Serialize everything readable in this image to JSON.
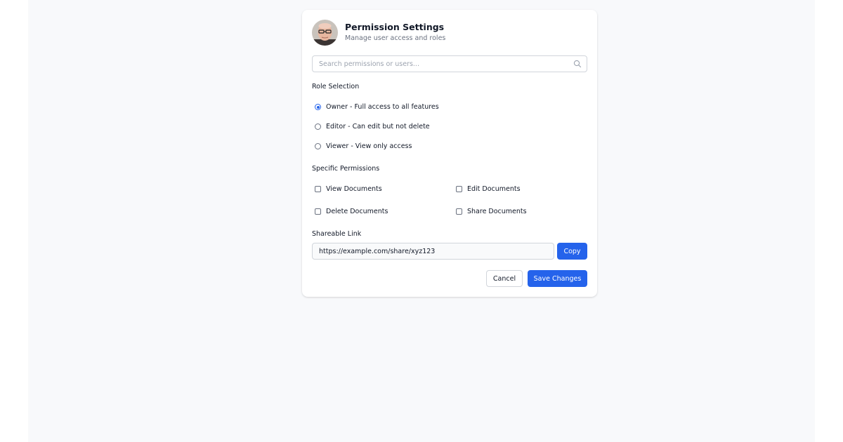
{
  "header": {
    "title": "Permission Settings",
    "subtitle": "Manage user access and roles",
    "avatar_icon": "user-avatar"
  },
  "search": {
    "placeholder": "Search permissions or users...",
    "value": "",
    "icon": "search-icon"
  },
  "roles": {
    "label": "Role Selection",
    "selected": "owner",
    "options": [
      {
        "id": "owner",
        "label": "Owner - Full access to all features"
      },
      {
        "id": "editor",
        "label": "Editor - Can edit but not delete"
      },
      {
        "id": "viewer",
        "label": "Viewer - View only access"
      }
    ]
  },
  "permissions": {
    "label": "Specific Permissions",
    "items": [
      {
        "label": "View Documents",
        "checked": false
      },
      {
        "label": "Edit Documents",
        "checked": false
      },
      {
        "label": "Delete Documents",
        "checked": false
      },
      {
        "label": "Share Documents",
        "checked": false
      }
    ]
  },
  "share": {
    "label": "Shareable Link",
    "url": "https://example.com/share/xyz123",
    "copy_label": "Copy"
  },
  "actions": {
    "cancel_label": "Cancel",
    "save_label": "Save Changes"
  },
  "colors": {
    "accent": "#2563eb",
    "background": "#f8f9fb",
    "card": "#ffffff",
    "border": "#d1d5db",
    "muted_text": "#6b7280"
  }
}
